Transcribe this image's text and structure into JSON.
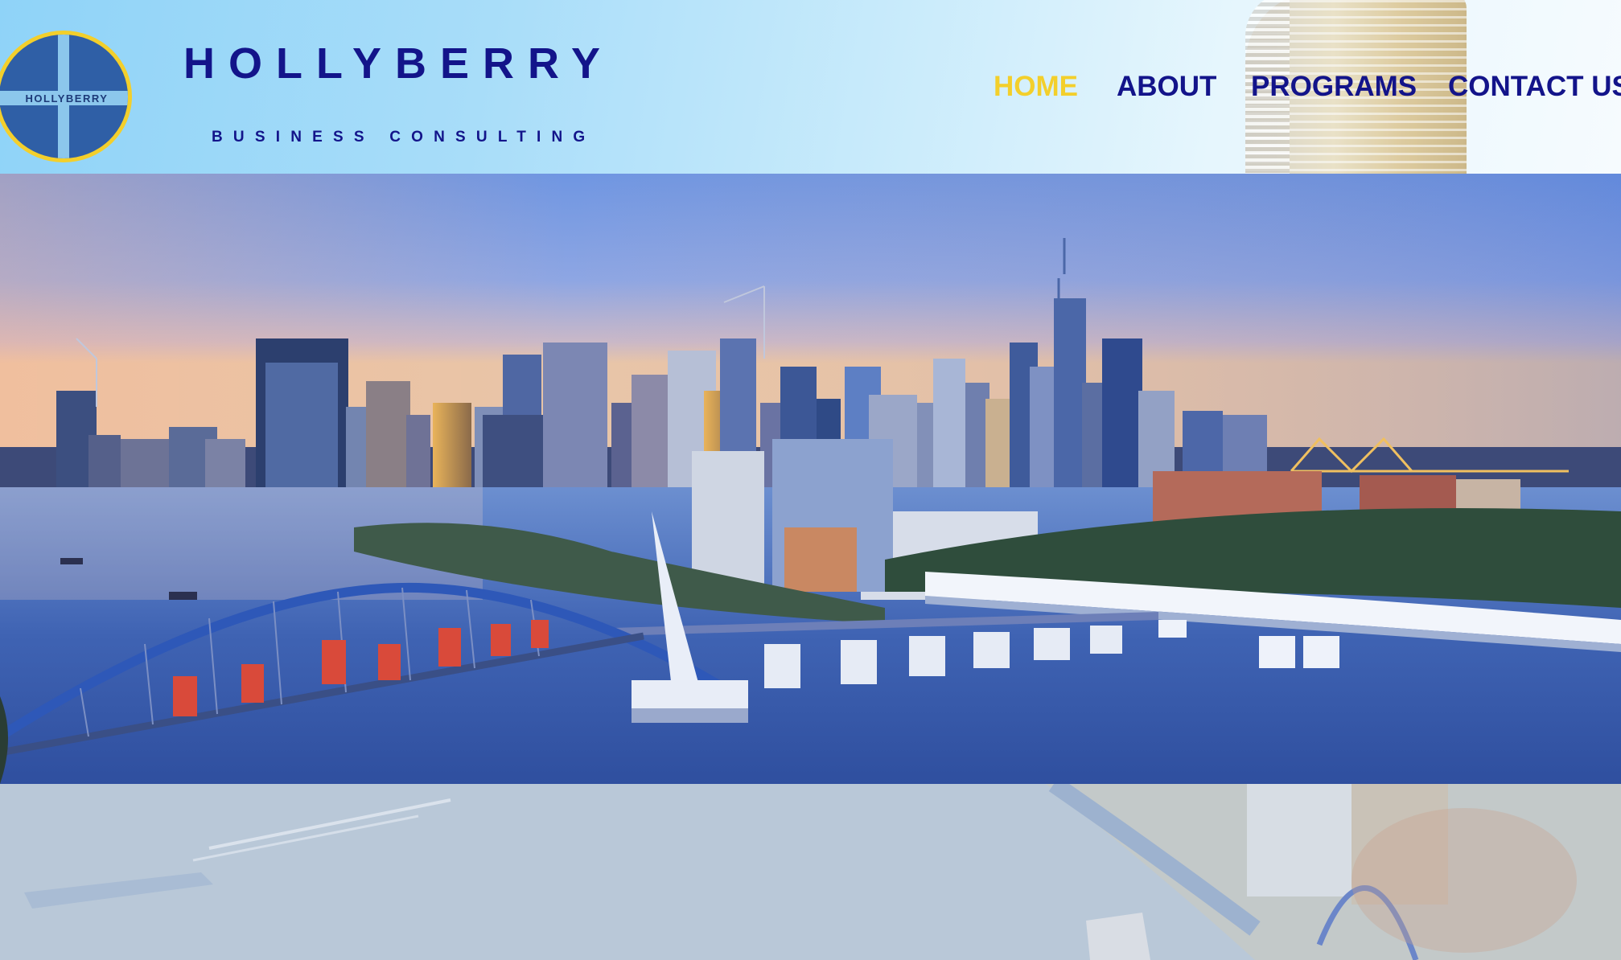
{
  "brand": {
    "logo_text": "HOLLYBERRY",
    "name": "HOLLYBERRY",
    "tagline": "BUSINESS CONSULTING"
  },
  "nav": {
    "items": [
      {
        "label": "HOME",
        "active": true
      },
      {
        "label": "ABOUT",
        "active": false
      },
      {
        "label": "PROGRAMS",
        "active": false
      },
      {
        "label": "CONTACT US",
        "active": false
      }
    ]
  },
  "hero": {
    "image": "city-skyline-river-bridges-photo"
  },
  "colors": {
    "brand_navy": "#13148a",
    "accent_yellow": "#f3cf2b",
    "logo_blue": "#2f5fa6"
  }
}
